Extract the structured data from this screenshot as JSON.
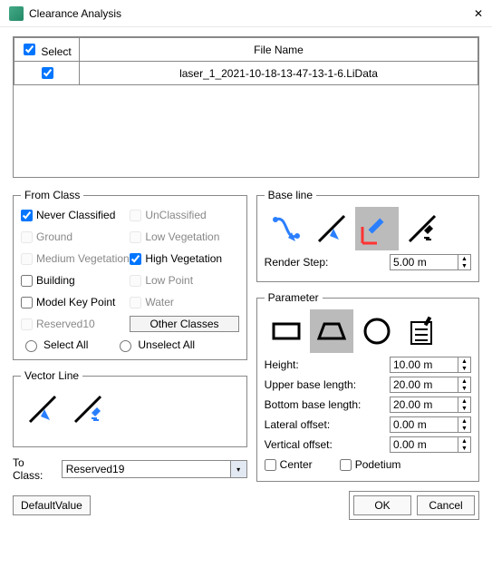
{
  "window": {
    "title": "Clearance Analysis",
    "close_glyph": "✕"
  },
  "file_table": {
    "col_select": "Select",
    "col_filename": "File Name",
    "rows": [
      {
        "checked": true,
        "name": "laser_1_2021-10-18-13-47-13-1-6.LiData"
      }
    ]
  },
  "from_class": {
    "legend": "From Class",
    "items": [
      {
        "label": "Never Classified",
        "checked": true,
        "enabled": true
      },
      {
        "label": "UnClassified",
        "checked": false,
        "enabled": false
      },
      {
        "label": "Ground",
        "checked": false,
        "enabled": false
      },
      {
        "label": "Low Vegetation",
        "checked": false,
        "enabled": false
      },
      {
        "label": "Medium Vegetation",
        "checked": false,
        "enabled": false
      },
      {
        "label": "High Vegetation",
        "checked": true,
        "enabled": true
      },
      {
        "label": "Building",
        "checked": false,
        "enabled": true
      },
      {
        "label": "Low Point",
        "checked": false,
        "enabled": false
      },
      {
        "label": "Model Key Point",
        "checked": false,
        "enabled": true
      },
      {
        "label": "Water",
        "checked": false,
        "enabled": false
      },
      {
        "label": "Reserved10",
        "checked": false,
        "enabled": false
      }
    ],
    "other_classes": "Other Classes",
    "select_all": "Select All",
    "unselect_all": "Unselect All"
  },
  "vector_line": {
    "legend": "Vector Line"
  },
  "base_line": {
    "legend": "Base line",
    "render_step_label": "Render Step:",
    "render_step_value": "5.00 m"
  },
  "parameter": {
    "legend": "Parameter",
    "height_label": "Height:",
    "height_value": "10.00 m",
    "upper_label": "Upper base length:",
    "upper_value": "20.00 m",
    "bottom_label": "Bottom base length:",
    "bottom_value": "20.00 m",
    "lateral_label": "Lateral offset:",
    "lateral_value": "0.00 m",
    "vertical_label": "Vertical offset:",
    "vertical_value": "0.00 m",
    "center_label": "Center",
    "podetium_label": "Podetium"
  },
  "to_class": {
    "label": "To Class:",
    "value": "Reserved19"
  },
  "buttons": {
    "default_value": "DefaultValue",
    "ok": "OK",
    "cancel": "Cancel"
  }
}
